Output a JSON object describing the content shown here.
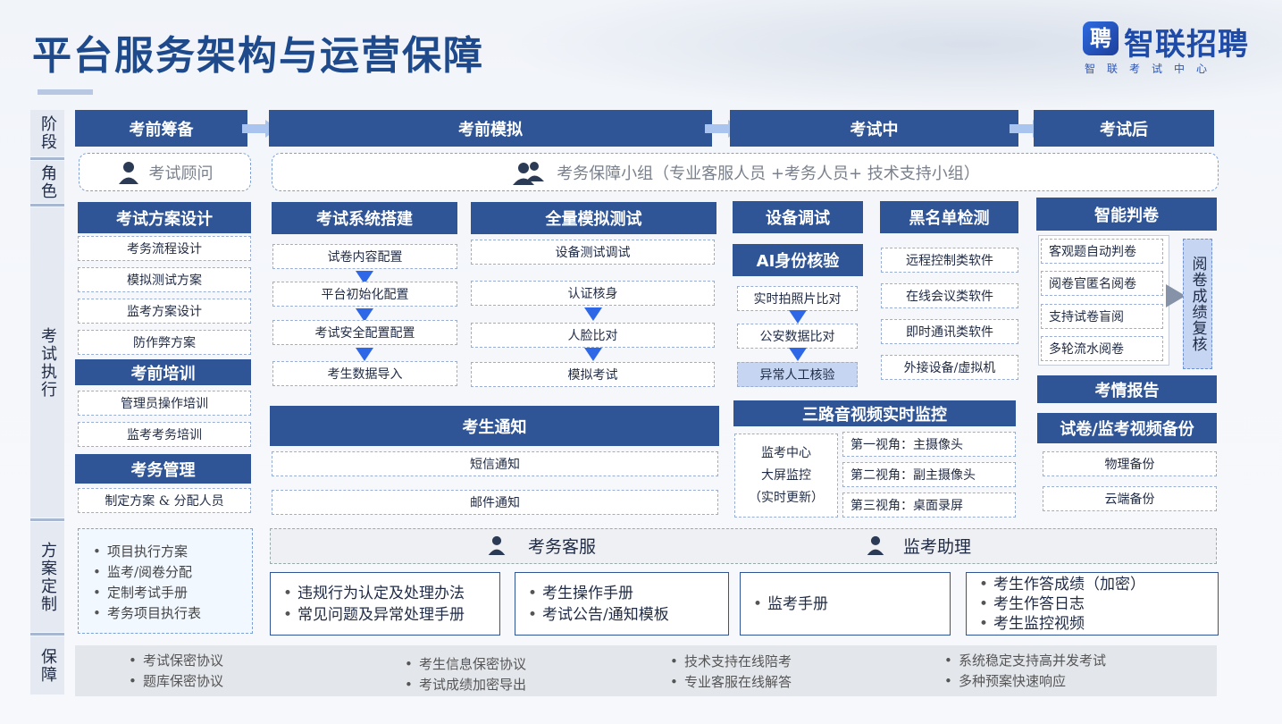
{
  "header": {
    "title": "平台服务架构与运营保障",
    "logo_mark": "聘",
    "logo_name": "智联招聘",
    "logo_sub": "智联考试中心"
  },
  "side_labels": {
    "stage": "阶段",
    "role": "角色",
    "execution": "考试执行",
    "plan": "方案定制",
    "guard": "保障"
  },
  "stages": [
    "考前筹备",
    "考前模拟",
    "考试中",
    "考试后"
  ],
  "roles": {
    "consultant": "考试顾问",
    "team": "考务保障小组（专业客服人员 +考务人员+ 技术支持小组）"
  },
  "prep": {
    "design_title": "考试方案设计",
    "design_items": [
      "考务流程设计",
      "模拟测试方案",
      "监考方案设计",
      "防作弊方案"
    ],
    "training_title": "考前培训",
    "training_items": [
      "管理员操作培训",
      "监考考务培训"
    ],
    "mgmt_title": "考务管理",
    "mgmt_items": [
      "制定方案 & 分配人员"
    ]
  },
  "sim": {
    "build_title": "考试系统搭建",
    "build_items": [
      "试卷内容配置",
      "平台初始化配置",
      "考试安全配置配置",
      "考生数据导入"
    ],
    "full_title": "全量模拟测试",
    "full_items": [
      "设备测试调试",
      "认证核身",
      "人脸比对",
      "模拟考试"
    ],
    "notice_title": "考生通知",
    "notice_items": [
      "短信通知",
      "邮件通知"
    ]
  },
  "during": {
    "device_title": "设备调试",
    "ai_title": "AI身份核验",
    "ai_items": [
      "实时拍照片比对",
      "公安数据比对",
      "异常人工核验"
    ],
    "blacklist_title": "黑名单检测",
    "blacklist_items": [
      "远程控制类软件",
      "在线会议类软件",
      "即时通讯类软件",
      "外接设备/虚拟机"
    ],
    "monitor_title": "三路音视频实时监控",
    "monitor_center": [
      "监考中心",
      "大屏监控",
      "（实时更新）"
    ],
    "monitor_items": [
      "第一视角：主摄像头",
      "第二视角：副主摄像头",
      "第三视角：桌面录屏"
    ]
  },
  "after": {
    "grading_title": "智能判卷",
    "grading_items": [
      "客观题自动判卷",
      "阅卷官匿名阅卷",
      "支持试卷盲阅",
      "多轮流水阅卷"
    ],
    "review": "阅卷成绩复核",
    "report_title": "考情报告",
    "backup_title": "试卷/监考视频备份",
    "backup_items": [
      "物理备份",
      "云端备份"
    ]
  },
  "plan": {
    "items": [
      "项目执行方案",
      "监考/阅卷分配",
      "定制考试手册",
      "考务项目执行表"
    ],
    "support_service": "考务客服",
    "support_assist": "监考助理",
    "docs": [
      [
        "违规行为认定及处理办法",
        "常见问题及异常处理手册"
      ],
      [
        "考生操作手册",
        "考试公告/通知模板"
      ],
      [
        "监考手册"
      ],
      [
        "考生作答成绩（加密）",
        "考生作答日志",
        "考生监控视频"
      ]
    ]
  },
  "guard": [
    [
      "考试保密协议",
      "题库保密协议"
    ],
    [
      "考生信息保密协议",
      "考试成绩加密导出"
    ],
    [
      "技术支持在线陪考",
      "专业客服在线解答"
    ],
    [
      "系统稳定支持高并发考试",
      "多种预案快速响应"
    ]
  ]
}
